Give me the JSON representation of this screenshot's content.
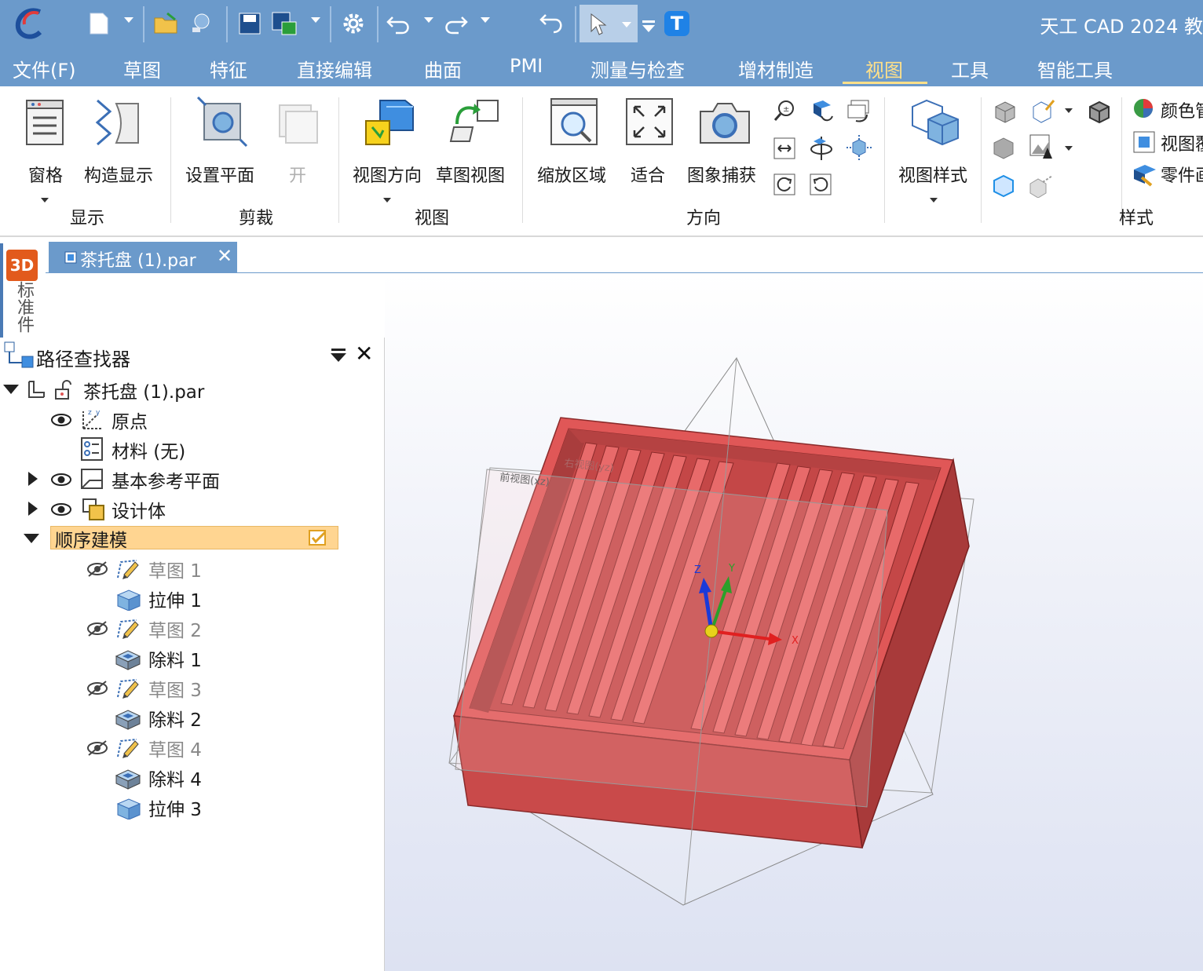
{
  "app": {
    "title": "天工 CAD 2024 教"
  },
  "menu": {
    "items": [
      "文件(F)",
      "草图",
      "特征",
      "直接编辑",
      "曲面",
      "PMI",
      "测量与检查",
      "增材制造",
      "视图",
      "工具",
      "智能工具"
    ],
    "active": "视图"
  },
  "ribbon": {
    "display": {
      "pane": "窗格",
      "construction": "构造显示",
      "group": "显示"
    },
    "clip": {
      "set_plane": "设置平面",
      "open": "开",
      "group": "剪裁"
    },
    "view": {
      "orientation": "视图方向",
      "sketch_view": "草图视图",
      "group": "视图"
    },
    "orient": {
      "zoom_area": "缩放区域",
      "fit": "适合",
      "capture": "图象捕获",
      "group": "方向"
    },
    "style": {
      "view_style": "视图样式",
      "color": "颜色管",
      "view_tag": "视图覆",
      "part": "零件画",
      "group": "样式"
    }
  },
  "document": {
    "tab": "茶托盘 (1).par"
  },
  "side_strip": {
    "badge": "3D",
    "label": "标准件"
  },
  "pathfinder": {
    "title": "路径查找器",
    "root": "茶托盘 (1).par",
    "items": {
      "origin": "原点",
      "material": "材料 (无)",
      "base_planes": "基本参考平面",
      "design_body": "设计体",
      "ordered": "顺序建模"
    },
    "features": [
      "草图 1",
      "拉伸 1",
      "草图 2",
      "除料 1",
      "草图 3",
      "除料 2",
      "草图 4",
      "除料 4",
      "拉伸 3"
    ]
  },
  "viewport": {
    "plane_labels": [
      "前视图(xz)",
      "右视图(yz)"
    ],
    "axes": {
      "x": "X",
      "y": "Y",
      "z": "Z"
    },
    "part_color": "#e05555"
  }
}
